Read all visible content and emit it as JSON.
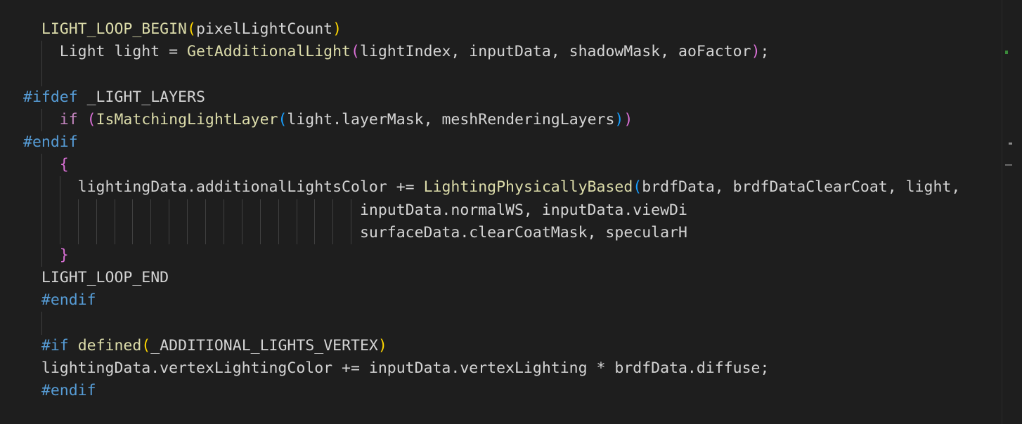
{
  "editor": {
    "lines": [
      {
        "indent": 2,
        "tokens": [
          {
            "t": "LIGHT_LOOP_BEGIN",
            "c": "fn"
          },
          {
            "t": "(",
            "c": "br1"
          },
          {
            "t": "pixelLightCount",
            "c": "id"
          },
          {
            "t": ")",
            "c": "br1"
          }
        ]
      },
      {
        "indent": 4,
        "tokens": [
          {
            "t": "Light light = ",
            "c": "id"
          },
          {
            "t": "GetAdditionalLight",
            "c": "fn"
          },
          {
            "t": "(",
            "c": "br2"
          },
          {
            "t": "lightIndex, inputData, shadowMask, aoFactor",
            "c": "id"
          },
          {
            "t": ")",
            "c": "br2"
          },
          {
            "t": ";",
            "c": "pl"
          }
        ]
      },
      {
        "indent": 0,
        "tokens": []
      },
      {
        "indent": 0,
        "tokens": [
          {
            "t": "#ifdef",
            "c": "kw"
          },
          {
            "t": " _LIGHT_LAYERS",
            "c": "id"
          }
        ]
      },
      {
        "indent": 4,
        "tokens": [
          {
            "t": "if",
            "c": "ctl"
          },
          {
            "t": " ",
            "c": "pl"
          },
          {
            "t": "(",
            "c": "br2"
          },
          {
            "t": "IsMatchingLightLayer",
            "c": "fn"
          },
          {
            "t": "(",
            "c": "br3"
          },
          {
            "t": "light.layerMask, meshRenderingLayers",
            "c": "id"
          },
          {
            "t": ")",
            "c": "br3"
          },
          {
            "t": ")",
            "c": "br2"
          }
        ]
      },
      {
        "indent": 0,
        "tokens": [
          {
            "t": "#endif",
            "c": "kw"
          }
        ]
      },
      {
        "indent": 4,
        "tokens": [
          {
            "t": "{",
            "c": "br2"
          }
        ]
      },
      {
        "indent": 6,
        "tokens": [
          {
            "t": "lightingData.additionalLightsColor += ",
            "c": "id"
          },
          {
            "t": "LightingPhysicallyBased",
            "c": "fn"
          },
          {
            "t": "(",
            "c": "br3"
          },
          {
            "t": "brdfData, brdfDataClearCoat, light,",
            "c": "id"
          }
        ]
      },
      {
        "indent": 37,
        "tokens": [
          {
            "t": "inputData.normalWS, inputData.viewDi",
            "c": "id"
          }
        ]
      },
      {
        "indent": 37,
        "tokens": [
          {
            "t": "surfaceData.clearCoatMask, specularH",
            "c": "id"
          }
        ]
      },
      {
        "indent": 4,
        "tokens": [
          {
            "t": "}",
            "c": "br2"
          }
        ]
      },
      {
        "indent": 2,
        "tokens": [
          {
            "t": "LIGHT_LOOP_END",
            "c": "id"
          }
        ]
      },
      {
        "indent": 2,
        "tokens": [
          {
            "t": "#endif",
            "c": "kw"
          }
        ]
      },
      {
        "indent": 0,
        "tokens": []
      },
      {
        "indent": 2,
        "tokens": [
          {
            "t": "#if",
            "c": "kw"
          },
          {
            "t": " ",
            "c": "pl"
          },
          {
            "t": "defined",
            "c": "fn"
          },
          {
            "t": "(",
            "c": "br1"
          },
          {
            "t": "_ADDITIONAL_LIGHTS_VERTEX",
            "c": "id"
          },
          {
            "t": ")",
            "c": "br1"
          }
        ]
      },
      {
        "indent": 2,
        "tokens": [
          {
            "t": "lightingData.vertexLightingColor += inputData.vertexLighting * brdfData.diffuse;",
            "c": "id"
          }
        ]
      },
      {
        "indent": 2,
        "tokens": [
          {
            "t": "#endif",
            "c": "kw"
          }
        ]
      }
    ]
  }
}
